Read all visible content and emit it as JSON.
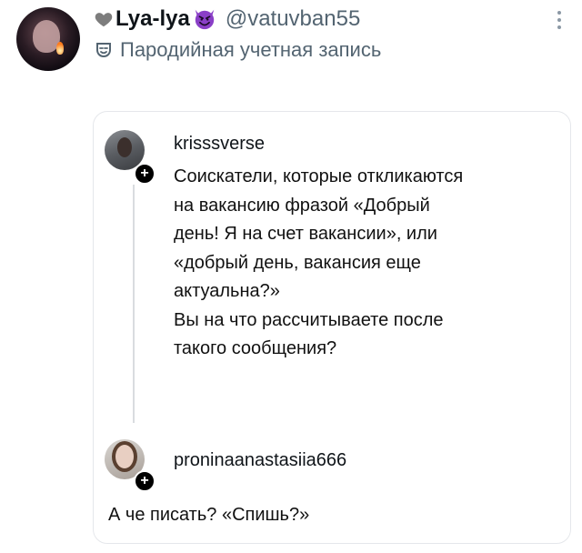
{
  "author": {
    "display_name": "Lya-lya",
    "handle": "@vatuvban55",
    "parody_label": "Пародийная учетная запись",
    "heart_icon": "grey-heart-icon",
    "emoji_icon": "smiling-devil-icon"
  },
  "quoted_post": {
    "username": "krisssverse",
    "lines": [
      "Соискатели, которые откликаются",
      "на вакансию фразой «Добрый",
      "день! Я на счет вакансии», или",
      "«добрый день, вакансия еще",
      "актуальна?»",
      "Вы на что рассчитываете после",
      "такого сообщения?"
    ]
  },
  "reply_post": {
    "username": "proninaanastasiia666",
    "text": "А че писать? «Спишь?»"
  },
  "badge_symbol": "+",
  "colors": {
    "secondary_text": "#536471",
    "devil_purple": "#8a3fc7",
    "heart_grey": "#7d7d7d",
    "card_border": "#e5e7eb"
  }
}
